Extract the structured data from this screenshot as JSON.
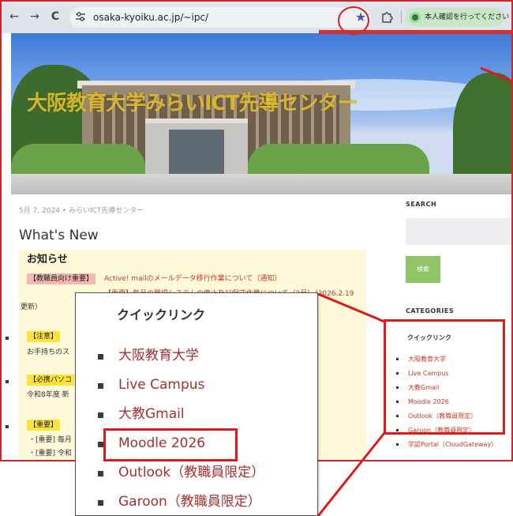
{
  "browser": {
    "nav_back": "←",
    "nav_forward": "→",
    "nav_reload": "C",
    "site_info_icon": "tune-icon",
    "url": "osaka-kyoiku.ac.jp/~ipc/",
    "bookmark_icon": "★",
    "extensions_icon": "puzzle-icon",
    "profile_label": "本人確認を行ってください",
    "menu_icon": "⋮"
  },
  "page": {
    "site_title": "大阪教育大学みらいICT先導センター",
    "meta": "5月 7, 2024 • みらいICT先導センター",
    "heading": "What's New",
    "notice": {
      "heading": "お知らせ",
      "row1_tag": "【教職員向け重要】",
      "row1_link": "Active! mailのメールデータ移行作業について（通知）",
      "row2_link": "【重要】毎月の職場システムの停止及び保守作業について（2月）（2026.2.19",
      "row2_tail": "更新）",
      "item1_tag": "【注意】",
      "item1_text": "お手持ちのス",
      "item2_tag": "【必携パソコ",
      "item2_text": "令和8年度 新",
      "item3_tag": "【重要】",
      "item3_line1": "・[重要] 毎月",
      "item3_line2": "・[重要] 令和"
    }
  },
  "sidebar": {
    "search_heading": "SEARCH",
    "search_button": "検索",
    "categories_heading": "CATEGORIES",
    "quicklink_title": "クイックリンク",
    "items": [
      "大阪教育大学",
      "Live Campus",
      "大教Gmail",
      "Moodle 2026",
      "Outlook（教職員限定）",
      "Garoon（教職員限定）",
      "学認Portal（CloudGateway）"
    ]
  },
  "popup": {
    "title": "クイックリンク",
    "items": [
      "大阪教育大学",
      "Live Campus",
      "大教Gmail",
      "Moodle 2026",
      "Outlook（教職員限定）",
      "Garoon（教職員限定）"
    ]
  },
  "colors": {
    "highlight": "#e01919",
    "link": "#c0392b",
    "notice_bg": "#fffad9",
    "search_button": "#8fc565"
  }
}
